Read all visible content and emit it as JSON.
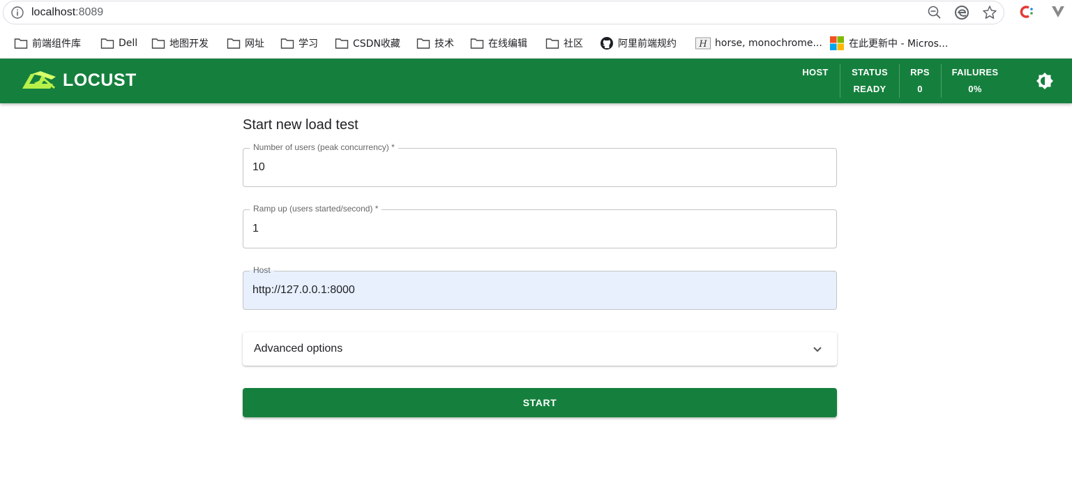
{
  "browser": {
    "url_host": "localhost",
    "url_port": ":8089"
  },
  "bookmarks": [
    {
      "label": "前端组件库",
      "icon": "folder-icon"
    },
    {
      "label": "Dell",
      "icon": "folder-icon"
    },
    {
      "label": "地图开发",
      "icon": "folder-icon"
    },
    {
      "label": "网址",
      "icon": "folder-icon"
    },
    {
      "label": "学习",
      "icon": "folder-icon"
    },
    {
      "label": "CSDN收藏",
      "icon": "folder-icon"
    },
    {
      "label": "技术",
      "icon": "folder-icon"
    },
    {
      "label": "在线编辑",
      "icon": "folder-icon"
    },
    {
      "label": "社区",
      "icon": "folder-icon"
    },
    {
      "label": "阿里前端规约",
      "icon": "github-icon"
    },
    {
      "label": "horse, monochrome...",
      "icon": "script-h-icon"
    },
    {
      "label": "在此更新中 - Micros...",
      "icon": "windows-icon"
    }
  ],
  "header": {
    "brand": "LOCUST",
    "stats": {
      "host_label": "HOST",
      "status_label": "STATUS",
      "status_value": "READY",
      "rps_label": "RPS",
      "rps_value": "0",
      "failures_label": "FAILURES",
      "failures_value": "0%"
    }
  },
  "form": {
    "title": "Start new load test",
    "users_label": "Number of users (peak concurrency) *",
    "users_value": "10",
    "ramp_label": "Ramp up (users started/second) *",
    "ramp_value": "1",
    "host_label": "Host",
    "host_value": "http://127.0.0.1:8000",
    "advanced_label": "Advanced options",
    "start_label": "START"
  },
  "colors": {
    "brand_green": "#15803d",
    "autofill_blue": "#e8f0fe"
  }
}
